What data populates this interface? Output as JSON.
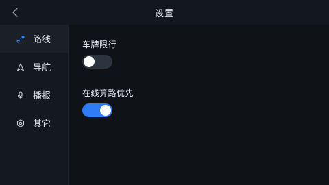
{
  "header": {
    "title": "设置",
    "back_icon": "chevron-left-icon"
  },
  "sidebar": {
    "items": [
      {
        "label": "路线",
        "icon": "route-icon",
        "active": true
      },
      {
        "label": "导航",
        "icon": "navigation-arrow-icon",
        "active": false
      },
      {
        "label": "播报",
        "icon": "microphone-icon",
        "active": false
      },
      {
        "label": "其它",
        "icon": "gear-icon",
        "active": false
      }
    ]
  },
  "settings": [
    {
      "label": "车牌限行",
      "enabled": false
    },
    {
      "label": "在线算路优先",
      "enabled": true
    }
  ],
  "colors": {
    "accent": "#2f7cf6",
    "toggle_off": "#2c3440",
    "background": "#0f1217",
    "sidebar": "#141921",
    "active_icon": "#3a8cff"
  }
}
